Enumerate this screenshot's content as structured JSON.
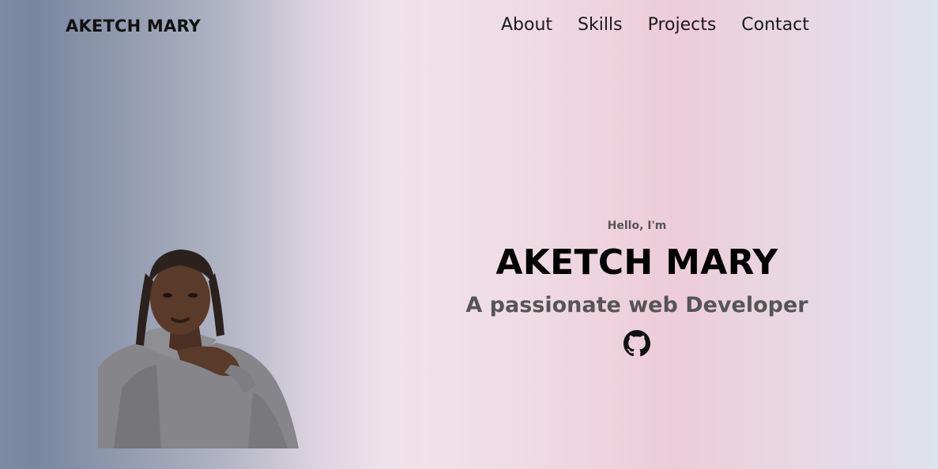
{
  "header": {
    "logo": "AKETCH MARY",
    "nav": [
      {
        "label": "About"
      },
      {
        "label": "Skills"
      },
      {
        "label": "Projects"
      },
      {
        "label": "Contact"
      }
    ]
  },
  "hero": {
    "greeting": "Hello, I'm",
    "name": "AKETCH MARY",
    "tagline": "A passionate web Developer",
    "social_icon": "github-icon"
  },
  "colors": {
    "text_dark": "#000000",
    "text_muted": "#555555",
    "gradient_left": "#7888a1",
    "gradient_center": "#f0e2ea",
    "gradient_pink": "#ecccd8",
    "gradient_right": "#dde2ed"
  }
}
